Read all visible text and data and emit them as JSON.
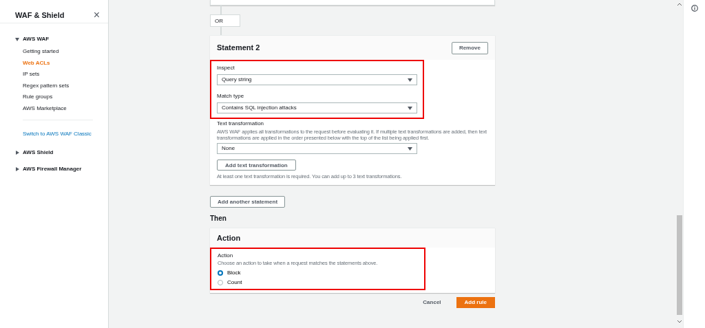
{
  "sidebar": {
    "title": "WAF & Shield",
    "close": "×",
    "sections": [
      {
        "label": "AWS WAF",
        "expanded": true,
        "items": [
          {
            "label": "Getting started",
            "selected": false
          },
          {
            "label": "Web ACLs",
            "selected": true
          },
          {
            "label": "IP sets",
            "selected": false
          },
          {
            "label": "Regex pattern sets",
            "selected": false
          },
          {
            "label": "Rule groups",
            "selected": false
          },
          {
            "label": "AWS Marketplace",
            "selected": false
          }
        ],
        "link": "Switch to AWS WAF Classic"
      },
      {
        "label": "AWS Shield",
        "expanded": false
      },
      {
        "label": "AWS Firewall Manager",
        "expanded": false
      }
    ]
  },
  "connector": "OR",
  "statement": {
    "title": "Statement 2",
    "remove_button": "Remove",
    "highlighted_fields": {
      "highlighted": true,
      "fields": [
        {
          "label": "Inspect",
          "value": "Query string"
        },
        {
          "label": "Match type",
          "value": "Contains SQL injection attacks"
        }
      ]
    },
    "text_transformation": {
      "label": "Text transformation",
      "description": "AWS WAF applies all transformations to the request before evaluating it. If multiple text transformations are added, then text transformations are applied in the order presented below with the top of the list being applied first.",
      "value": "None",
      "add_button": "Add text transformation",
      "hint": "At least one text transformation is required. You can add up to 3 text transformations."
    }
  },
  "add_statement_button": "Add another statement",
  "then_heading": "Then",
  "action": {
    "title": "Action",
    "highlighted": true,
    "label": "Action",
    "description": "Choose an action to take when a request matches the statements above.",
    "options": [
      {
        "label": "Block",
        "selected": true
      },
      {
        "label": "Count",
        "selected": false
      }
    ]
  },
  "footer": {
    "cancel": "Cancel",
    "submit": "Add rule"
  }
}
